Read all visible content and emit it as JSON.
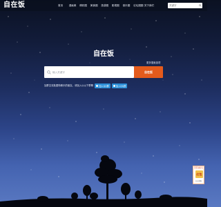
{
  "header": {
    "logo": "自在饭",
    "nav": [
      "首页",
      "漫画美",
      "精彩图",
      "美食圈",
      "旅游圈",
      "影视圈",
      "音乐圈",
      "论坛圈圈",
      "关于我们"
    ],
    "search_placeholder": "关键字"
  },
  "main": {
    "brand": "自在饭",
    "more_link": "更多搜索选项",
    "search_placeholder": "输入关键字",
    "search_button": "自在饭",
    "promo_text": "加群交流批图特斯乐的朋友。请加入以以下群聊",
    "join_buttons": [
      "加入QQ群",
      "加入QQ群"
    ]
  },
  "side_widget": {
    "title": "天天领红包",
    "badge": "红包",
    "footer": "点击领取"
  },
  "icons": [
    "search-icon",
    "tree-silhouette",
    "qq-icon",
    "red-envelope-icon"
  ],
  "colors": {
    "accent": "#e45b1c",
    "join": "#2b8fd8",
    "sky_top": "#0b1122",
    "sky_bottom": "#5a79c2"
  }
}
